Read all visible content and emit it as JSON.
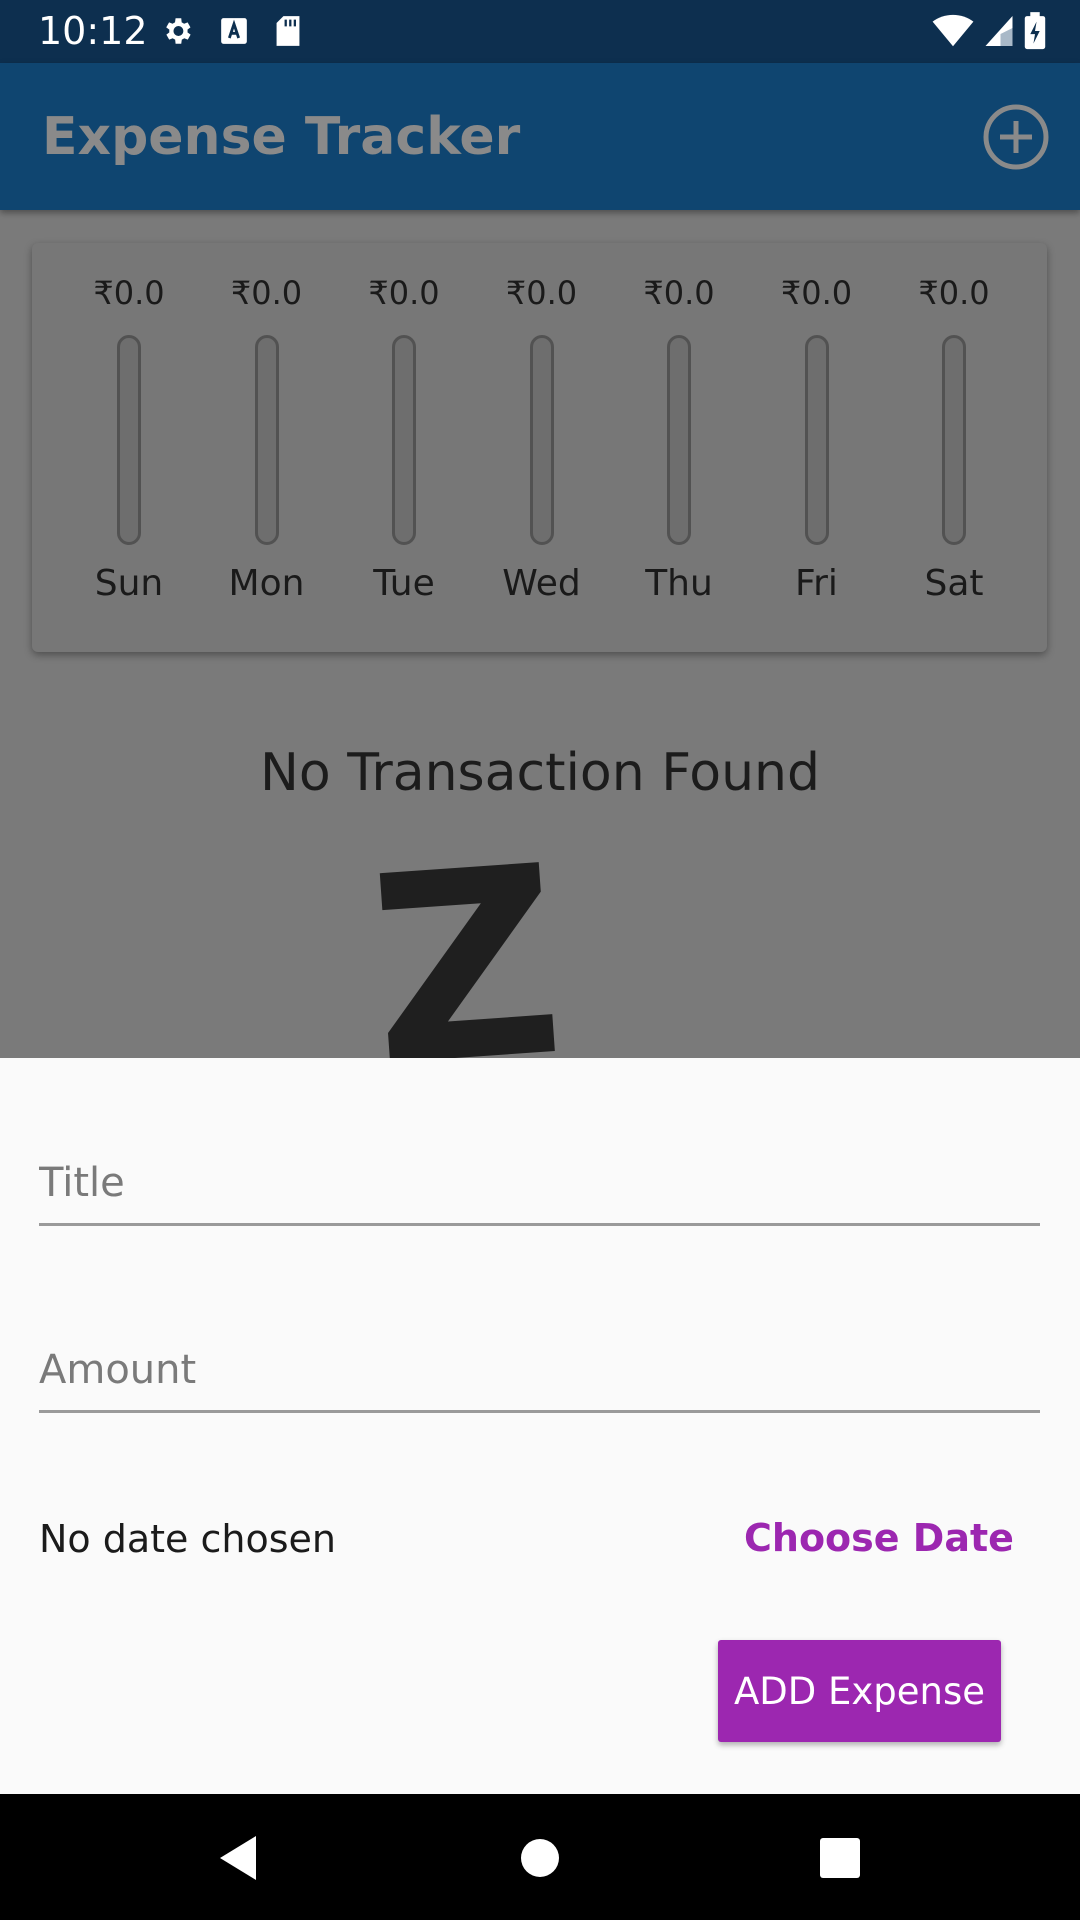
{
  "status_bar": {
    "time": "10:12",
    "left_icons": [
      "gear-icon",
      "a-badge-icon",
      "sd-card-icon"
    ],
    "right_icons": [
      "wifi-icon",
      "signal-icon",
      "battery-charging-icon"
    ]
  },
  "app_bar": {
    "title": "Expense Tracker",
    "action_icon": "add-circle-icon"
  },
  "chart_data": {
    "type": "bar",
    "categories": [
      "Sun",
      "Mon",
      "Tue",
      "Wed",
      "Thu",
      "Fri",
      "Sat"
    ],
    "values": [
      0.0,
      0.0,
      0.0,
      0.0,
      0.0,
      0.0,
      0.0
    ],
    "value_labels": [
      "₹0.0",
      "₹0.0",
      "₹0.0",
      "₹0.0",
      "₹0.0",
      "₹0.0",
      "₹0.0"
    ],
    "spending_fraction": [
      0,
      0,
      0,
      0,
      0,
      0,
      0
    ]
  },
  "empty_state": {
    "message": "No Transaction Found",
    "art": "Z"
  },
  "sheet": {
    "title_placeholder": "Title",
    "amount_placeholder": "Amount",
    "title_value": "",
    "amount_value": "",
    "date_text": "No date chosen",
    "choose_date_label": "Choose Date",
    "submit_label": "ADD Expense"
  },
  "colors": {
    "status_bar": "#0d2f4f",
    "app_bar": "#0f4570",
    "accent": "#9c27b0"
  },
  "nav_bar": {
    "buttons": [
      "back-icon",
      "home-icon",
      "recents-icon"
    ]
  }
}
